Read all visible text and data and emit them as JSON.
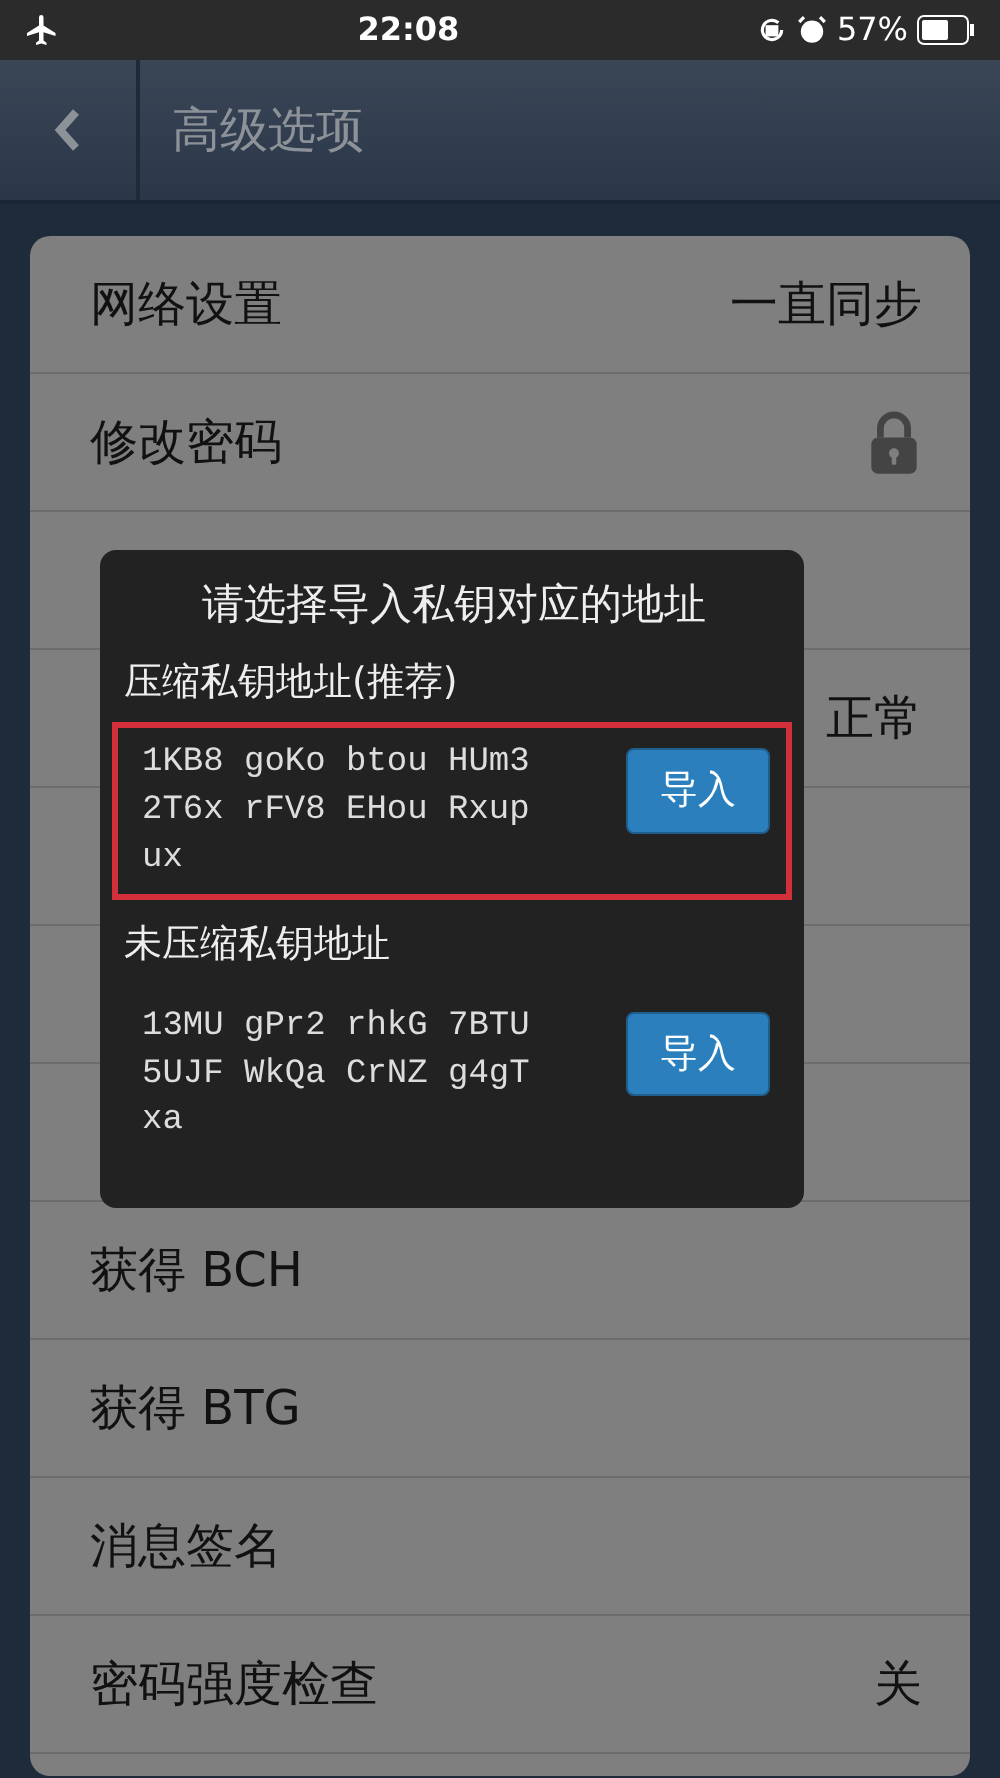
{
  "status_bar": {
    "time": "22:08",
    "battery": "57%"
  },
  "header": {
    "title": "高级选项"
  },
  "settings": [
    {
      "label": "网络设置",
      "value": "一直同步"
    },
    {
      "label": "修改密码",
      "kind": "lock"
    },
    {
      "kind": "covered"
    },
    {
      "value": "正常"
    },
    {
      "kind": "covered"
    },
    {
      "kind": "covered"
    },
    {
      "kind": "covered"
    },
    {
      "label": "获得 BCH"
    },
    {
      "label": "获得 BTG"
    },
    {
      "label": "消息签名"
    },
    {
      "label": "密码强度检查",
      "value": "关"
    },
    {
      "kind": "covered"
    }
  ],
  "dialog": {
    "title": "请选择导入私钥对应的地址",
    "options": [
      {
        "heading": "压缩私钥地址(推荐)",
        "address": "1KB8 goKo btou HUm3 2T6x rFV8 EHou Rxup ux",
        "button": "导入",
        "highlighted": true
      },
      {
        "heading": "未压缩私钥地址",
        "address": "13MU gPr2 rhkG 7BTU 5UJF WkQa CrNZ g4gT xa",
        "button": "导入",
        "highlighted": false
      }
    ]
  }
}
